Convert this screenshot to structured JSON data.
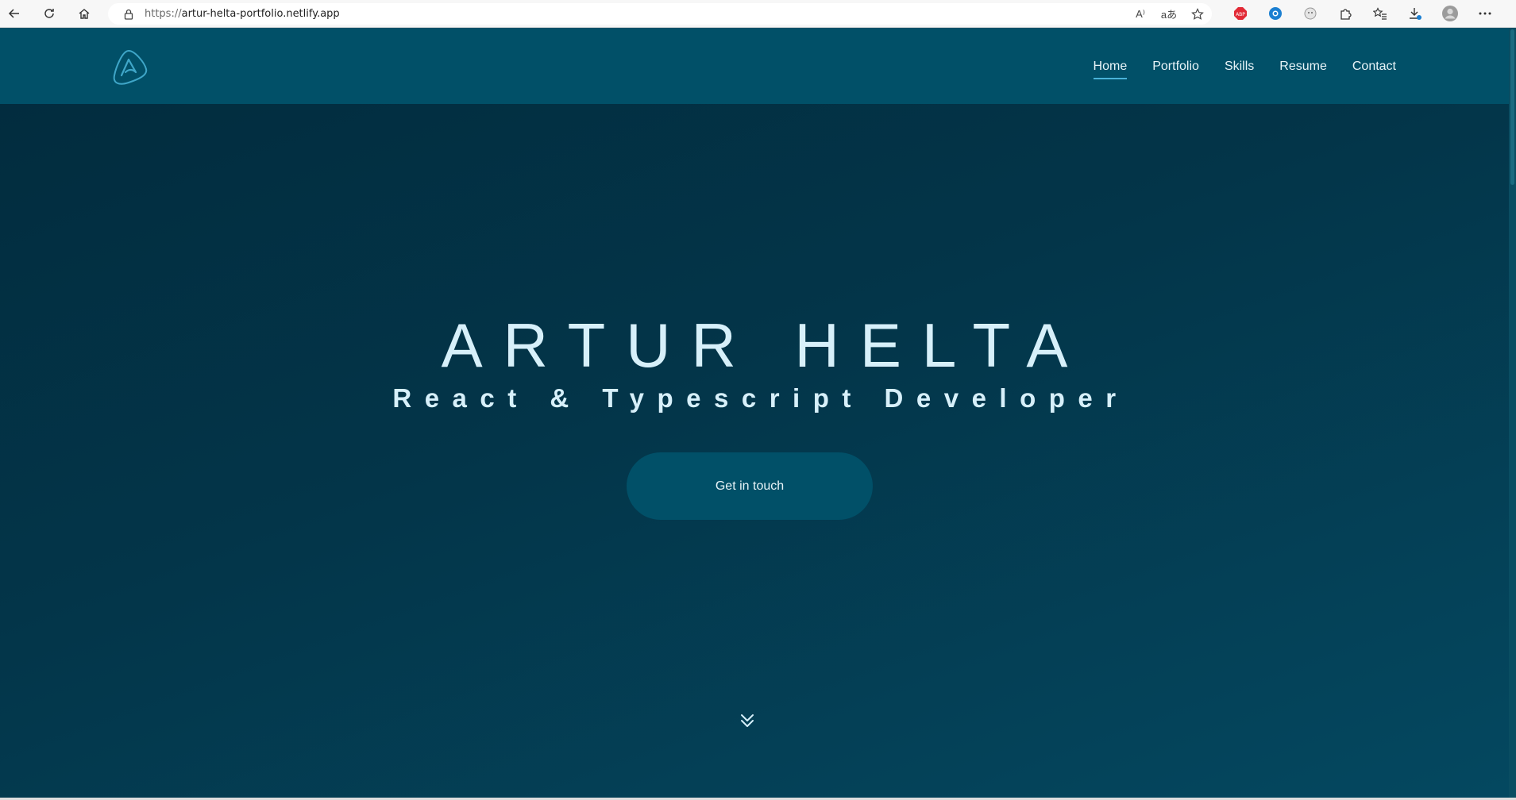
{
  "browser": {
    "url_scheme": "https://",
    "url_host": "artur-helta-portfolio.netlify.app",
    "icons": {
      "back": "back-arrow-icon",
      "refresh": "refresh-icon",
      "home": "home-icon",
      "lock": "lock-icon",
      "read_aloud": "read-aloud-icon",
      "translate": "translate-icon",
      "favorite": "add-favorite-icon",
      "adblock": "adblock-plus-icon",
      "extension_blue": "extension-blue-icon",
      "extension_gray": "extension-gray-icon",
      "extensions": "extensions-puzzle-icon",
      "favorites": "favorites-list-icon",
      "downloads": "downloads-icon",
      "profile": "profile-avatar-icon",
      "menu": "more-menu-icon"
    },
    "read_aloud_label": "A⁾",
    "translate_label": "aあ",
    "adblock_label": "ABP"
  },
  "site": {
    "logo_icon": "logo-icon",
    "nav": {
      "home": "Home",
      "portfolio": "Portfolio",
      "skills": "Skills",
      "resume": "Resume",
      "contact": "Contact"
    },
    "hero": {
      "title": "ARTUR HELTA",
      "subtitle": "React & Typescript Developer",
      "cta": "Get in touch"
    },
    "scroll_icon": "double-chevron-down-icon"
  },
  "colors": {
    "navbar": "#015068",
    "background_start": "#022b3d",
    "background_end": "#044860",
    "text": "#d7f0fa",
    "accent": "#49b3d8"
  }
}
